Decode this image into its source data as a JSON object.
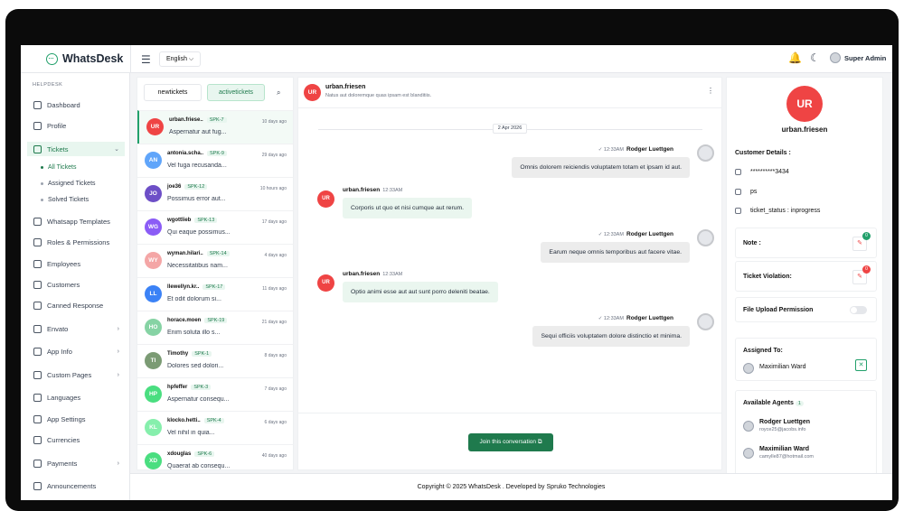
{
  "app": {
    "name": "WhatsDesk"
  },
  "header": {
    "language": "English",
    "language_chevron": "⌵",
    "user_name": "Super Admin",
    "menu_icon": "☰",
    "bell_icon": "🔔",
    "moon_icon": "☾"
  },
  "sidebar": {
    "category": "HELPDESK",
    "items": [
      {
        "label": "Dashboard"
      },
      {
        "label": "Profile"
      },
      {
        "label": "Tickets"
      },
      {
        "label": "Whatsapp Templates"
      },
      {
        "label": "Roles & Permissions"
      },
      {
        "label": "Employees"
      },
      {
        "label": "Customers"
      },
      {
        "label": "Canned Response"
      },
      {
        "label": "Envato"
      },
      {
        "label": "App Info"
      },
      {
        "label": "Custom Pages"
      },
      {
        "label": "Languages"
      },
      {
        "label": "App Settings"
      },
      {
        "label": "Currencies"
      },
      {
        "label": "Payments"
      },
      {
        "label": "Announcements"
      }
    ],
    "subitems": [
      {
        "label": "All Tickets"
      },
      {
        "label": "Assigned Tickets"
      },
      {
        "label": "Solved Tickets"
      }
    ],
    "chevron": "›",
    "chevron_open": "⌄"
  },
  "tickets": {
    "tabs": [
      {
        "label": "newtickets"
      },
      {
        "label": "activetickets"
      }
    ],
    "search_icon": "⌕",
    "rows": [
      {
        "initials": "UR",
        "name": "urban.friese..",
        "code": "SPK-7",
        "subject": "Aspernatur aut fug...",
        "time": "10 days ago",
        "color": "#ef4444"
      },
      {
        "initials": "AN",
        "name": "antonia.scha..",
        "code": "SPK-9",
        "subject": "Vel fuga recusanda...",
        "time": "29 days ago",
        "color": "#60a5fa"
      },
      {
        "initials": "JO",
        "name": "joe36",
        "code": "SPK-12",
        "subject": "Possimus error aut...",
        "time": "10 hours ago",
        "color": "#6d4fc7"
      },
      {
        "initials": "WG",
        "name": "wgottlieb",
        "code": "SPK-13",
        "subject": "Qui eaque possimus...",
        "time": "17 days ago",
        "color": "#8b5cf6"
      },
      {
        "initials": "WY",
        "name": "wyman.hilari..",
        "code": "SPK-14",
        "subject": "Necessitatibus nam...",
        "time": "4 days ago",
        "color": "#f4a6a6"
      },
      {
        "initials": "LL",
        "name": "llewellyn.kr..",
        "code": "SPK-17",
        "subject": "Et odit dolorum si...",
        "time": "11 days ago",
        "color": "#3b82f6"
      },
      {
        "initials": "HO",
        "name": "horace.moen",
        "code": "SPK-19",
        "subject": "Enim soluta illo s...",
        "time": "21 days ago",
        "color": "#86d3a4"
      },
      {
        "initials": "TI",
        "name": "Timothy",
        "code": "SPK-1",
        "subject": "Dolores sed dolori...",
        "time": "8 days ago",
        "color": "#7b9b74"
      },
      {
        "initials": "HP",
        "name": "hpfeffer",
        "code": "SPK-3",
        "subject": "Aspernatur consequ...",
        "time": "7 days ago",
        "color": "#4ade80"
      },
      {
        "initials": "KL",
        "name": "klocko.hetti..",
        "code": "SPK-4",
        "subject": "Vel nihil in quia...",
        "time": "6 days ago",
        "color": "#86efac"
      },
      {
        "initials": "XD",
        "name": "xdouglas",
        "code": "SPK-6",
        "subject": "Quaerat ab consequ...",
        "time": "40 days ago",
        "color": "#4ade80"
      }
    ]
  },
  "chat": {
    "contact_initials": "UR",
    "contact_name": "urban.friesen",
    "contact_desc": "Natus aut doloremque quas ipsam est blanditiis.",
    "kebab": "⋮",
    "date": "2 Apr 2026",
    "messages": [
      {
        "direction": "out",
        "sender": "Rodger Luettgen",
        "time": "12:33AM",
        "check": "✓",
        "text": "Omnis dolorem reiciendis voluptatem totam et ipsam id aut."
      },
      {
        "direction": "in",
        "sender": "urban.friesen",
        "initials": "UR",
        "time": "12:33AM",
        "text": "Corporis ut quo et nisi cumque aut rerum."
      },
      {
        "direction": "out",
        "sender": "Rodger Luettgen",
        "time": "12:33AM",
        "check": "✓",
        "text": "Earum neque omnis temporibus aut facere vitae."
      },
      {
        "direction": "in",
        "sender": "urban.friesen",
        "initials": "UR",
        "time": "12:33AM",
        "text": "Optio animi esse aut aut sunt porro deleniti beatae."
      },
      {
        "direction": "out",
        "sender": "Rodger Luettgen",
        "time": "12:33AM",
        "check": "✓",
        "text": "Sequi officiis voluptatem dolore distinctio et minima."
      }
    ],
    "join_button": "Join this conversation"
  },
  "details": {
    "initials": "UR",
    "name": "urban.friesen",
    "heading": "Customer Details :",
    "phone": "**********3434",
    "ps": "ps",
    "status": "ticket_status : inprogress",
    "note_label": "Note :",
    "note_count": "0",
    "violation_label": "Ticket Violation:",
    "violation_count": "0",
    "upload_label": "File Upload Permission",
    "assigned_label": "Assigned To:",
    "assigned_name": "Maximilian Ward",
    "remove_icon": "✕",
    "edit_icon": "✎",
    "agents_label": "Available Agents",
    "agents_count": "1",
    "agents": [
      {
        "name": "Rodger Luettgen",
        "email": "royce25@jacobs.info"
      },
      {
        "name": "Maximilian Ward",
        "email": "camylle87@hotmail.com"
      }
    ]
  },
  "footer": {
    "text": "Copyright © 2025 WhatsDesk . Developed by Spruko Technologies"
  },
  "colors": {
    "brand": "#1f7a4d",
    "accent": "#22a06b",
    "avatar_red": "#ef4444"
  }
}
